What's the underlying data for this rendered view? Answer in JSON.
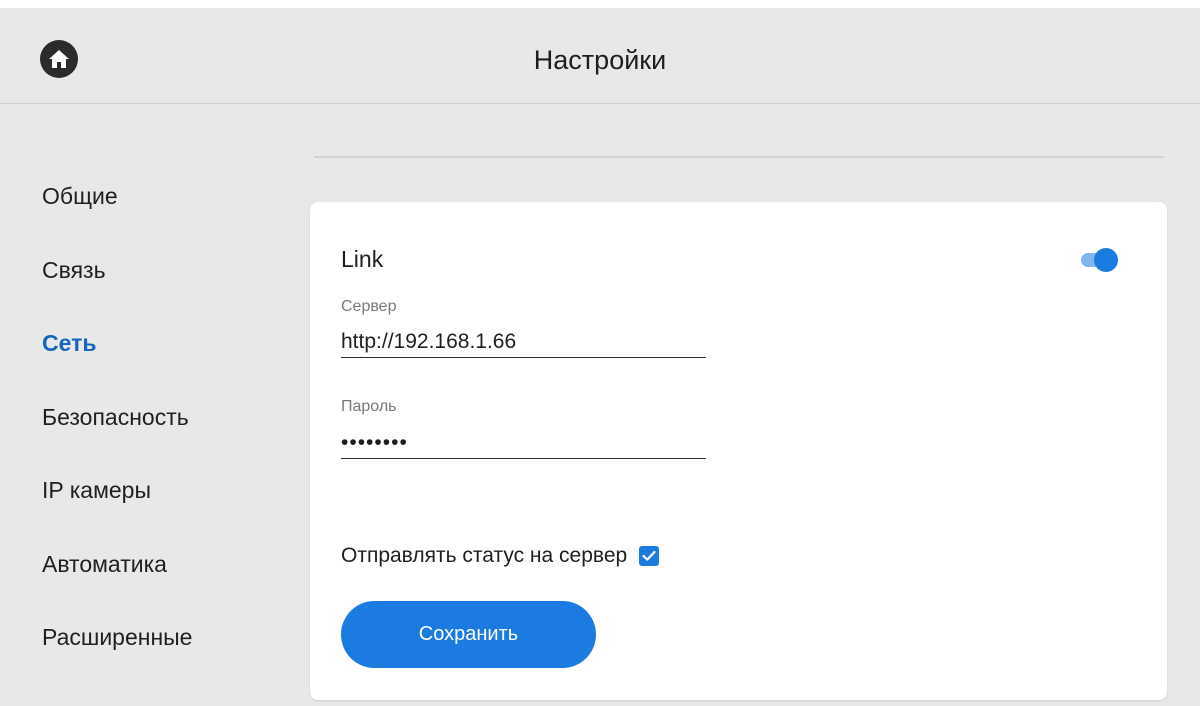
{
  "header": {
    "title": "Настройки",
    "home_icon": "home-icon"
  },
  "sidebar": {
    "active_color": "#1565c0",
    "items": [
      {
        "label": "Общие",
        "active": false
      },
      {
        "label": "Связь",
        "active": false
      },
      {
        "label": "Сеть",
        "active": true
      },
      {
        "label": "Безопасность",
        "active": false
      },
      {
        "label": "IP камеры",
        "active": false
      },
      {
        "label": "Автоматика",
        "active": false
      },
      {
        "label": "Расширенные",
        "active": false
      }
    ]
  },
  "link_card": {
    "title": "Link",
    "enabled": true,
    "server": {
      "label": "Сервер",
      "value": "http://192.168.1.66"
    },
    "password": {
      "label": "Пароль",
      "value": "••••••••"
    },
    "send_status": {
      "label": "Отправлять статус на сервер",
      "checked": true
    },
    "save_label": "Сохранить"
  },
  "colors": {
    "accent": "#1b7be0",
    "toggle_track": "#7fb6ee",
    "background": "#e8e8e8",
    "card": "#ffffff"
  }
}
